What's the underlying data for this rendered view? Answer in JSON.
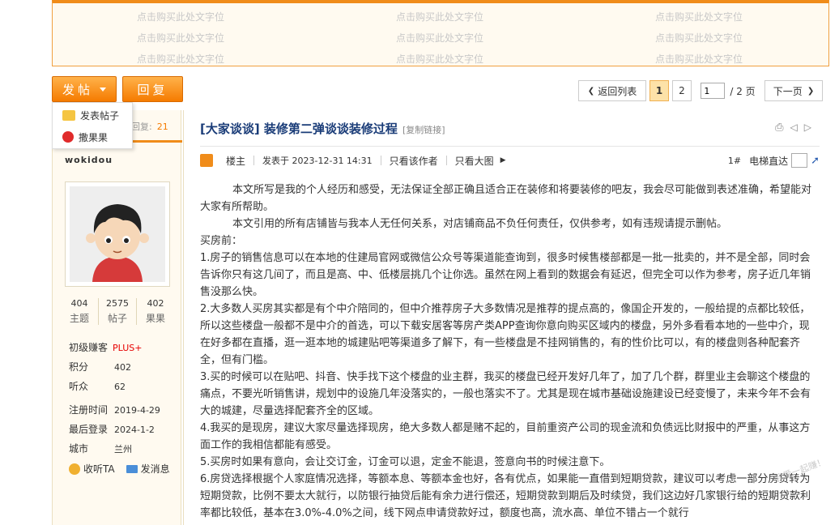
{
  "ad": {
    "text": "点击购买此处文字位"
  },
  "toolbar": {
    "post_label": "发帖",
    "reply_label": "回复"
  },
  "dropdown": {
    "items": [
      "发表帖子",
      "撒果果"
    ]
  },
  "pager": {
    "back_label": "返回列表",
    "pages": [
      "1",
      "2"
    ],
    "current_page": "1",
    "page_input": "1",
    "total_label": "/ 2 页",
    "next_label": "下一页"
  },
  "sidebar": {
    "reply_label": "回复:",
    "reply_count": "21",
    "username": "wokidou",
    "stats": [
      {
        "n": "404",
        "l": "主题"
      },
      {
        "n": "2575",
        "l": "帖子"
      },
      {
        "n": "402",
        "l": "果果"
      }
    ],
    "rank": "初级赚客",
    "plus": "PLUS+",
    "info": [
      {
        "k": "积分",
        "v": "402"
      },
      {
        "k": "听众",
        "v": "62"
      },
      {
        "k": "注册时间",
        "v": "2019-4-29"
      },
      {
        "k": "最后登录",
        "v": "2024-1-2"
      },
      {
        "k": "城市",
        "v": "兰州"
      }
    ],
    "listen": "收听TA",
    "message": "发消息"
  },
  "post": {
    "title": "[大家谈谈] 装修第二弹谈谈装修过程",
    "copy_link": "[复制链接]",
    "author_role": "楼主",
    "posted": "发表于 2023-12-31 14:31",
    "only_author": "只看该作者",
    "big_image": "只看大图",
    "floor": "1#",
    "elevator": "电梯直达",
    "paragraphs": [
      "本文所写是我的个人经历和感受，无法保证全部正确且适合正在装修和将要装修的吧友，我会尽可能做到表述准确，希望能对大家有所帮助。",
      "本文引用的所有店铺皆与我本人无任何关系，对店铺商品不负任何责任，仅供参考，如有违规请提示删帖。",
      "买房前：",
      "1.房子的销售信息可以在本地的住建局官网或微信公众号等渠道能查询到，很多时候售楼部都是一批一批卖的，并不是全部，同时会告诉你只有这几间了，而且是高、中、低楼层挑几个让你选。虽然在网上看到的数据会有延迟，但完全可以作为参考，房子近几年销售没那么快。",
      "2.大多数人买房其实都是有个中介陪同的，但中介推荐房子大多数情况是推荐的提点高的，像国企开发的，一般给提的点都比较低，所以这些楼盘一般都不是中介的首选，可以下载安居客等房产类APP查询你意向购买区域内的楼盘，另外多看看本地的一些中介，现在好多都在直播，逛一逛本地的城建贴吧等渠道多了解下，有一些楼盘是不挂网销售的，有的性价比可以，有的楼盘则各种配套齐全，但有门槛。",
      "3.买的时候可以在贴吧、抖音、快手找下这个楼盘的业主群，我买的楼盘已经开发好几年了，加了几个群，群里业主会聊这个楼盘的痛点，不要光听销售讲，规划中的设施几年没落实的，一般也落实不了。尤其是现在城市基础设施建设已经变慢了，未来今年不会有大的城建，尽量选择配套齐全的区域。",
      "4.我买的是现房，建议大家尽量选择现房，绝大多数人都是赌不起的，目前重资产公司的现金流和负债远比财报中的严重，从事这方面工作的我相信都能有感受。",
      "5.买房时如果有意向，会让交订金，订金可以退，定金不能退，签意向书的时候注意下。",
      "6.房贷选择根据个人家庭情况选择，等额本息、等额本金也好，各有优点，如果能一直借到短期贷款，建议可以考虑一部分房贷转为短期贷款，比例不要太大就行，以防银行抽贷后能有余力进行偿还，短期贷款到期后及时续贷，我们这边好几家银行给的短期贷款利率都比较低，基本在3.0%-4.0%之间，线下网点申请贷款好过，额度也高，流水高、单位不错占一个就行"
    ]
  },
  "watermark": "我爱一起赚！"
}
